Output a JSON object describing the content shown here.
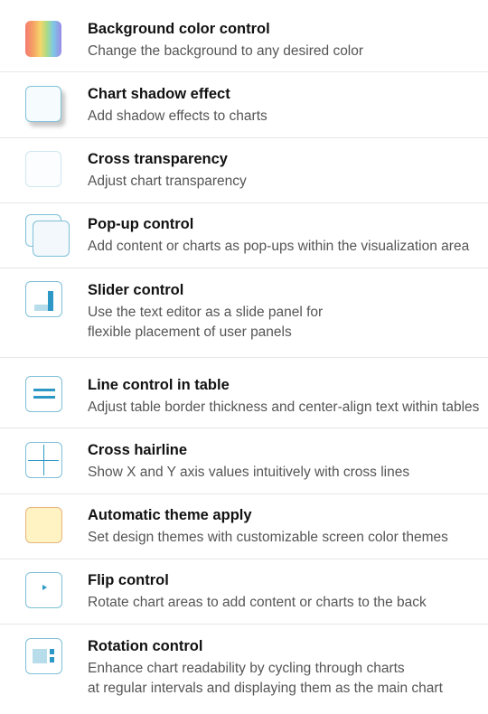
{
  "features": [
    {
      "title": "Background color control",
      "description": [
        "Change the background to any desired color"
      ],
      "icon": "rainbow-gradient-icon"
    },
    {
      "title": "Chart shadow effect",
      "description": [
        "Add shadow effects to charts"
      ],
      "icon": "shadow-box-icon"
    },
    {
      "title": "Cross transparency",
      "description": [
        "Adjust chart transparency"
      ],
      "icon": "transparent-box-icon"
    },
    {
      "title": "Pop-up control",
      "description": [
        "Add content or charts as pop-ups within the visualization area"
      ],
      "icon": "popup-windows-icon"
    },
    {
      "title": "Slider control",
      "description": [
        "Use the text editor as a slide panel for",
        "flexible placement of user panels"
      ],
      "icon": "slider-panel-icon"
    },
    {
      "title": "Line control in table",
      "description": [
        "Adjust table border thickness and center-align text within tables"
      ],
      "icon": "table-lines-icon"
    },
    {
      "title": "Cross hairline",
      "description": [
        "Show X and Y axis values intuitively with cross lines"
      ],
      "icon": "crosshair-icon"
    },
    {
      "title": "Automatic theme apply",
      "description": [
        "Set design themes with customizable screen color themes"
      ],
      "icon": "theme-swatch-icon"
    },
    {
      "title": "Flip control",
      "description": [
        "Rotate chart areas to add content or charts to the back"
      ],
      "icon": "flip-arrow-icon"
    },
    {
      "title": "Rotation control",
      "description": [
        "Enhance chart readability by cycling through charts",
        "at regular intervals and displaying them as the main chart"
      ],
      "icon": "rotation-layout-icon"
    }
  ],
  "colors": {
    "accent": "#2d98c5",
    "icon_border": "#7fc0d8",
    "divider": "#e6e6e6",
    "theme_fill": "#fff3c4",
    "theme_border": "#e7b57e"
  }
}
